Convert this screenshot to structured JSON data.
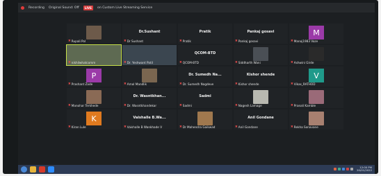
{
  "topbar": {
    "recording": "Recording",
    "audio": "Original Sound: Off",
    "live": "LIVE",
    "stream": "on Custom Live Streaming Service"
  },
  "participants": [
    {
      "label": "Rupali Pol",
      "kind": "photo",
      "color": "#6d5a4a"
    },
    {
      "label": "Dr Sushant",
      "center": "Dr.Sushant",
      "kind": "name"
    },
    {
      "label": "Pratik",
      "center": "Pratik",
      "kind": "name"
    },
    {
      "label": "Pankaj gosavi",
      "center": "Pankaj gosavi",
      "kind": "name"
    },
    {
      "label": "Manoj1983 Vaze",
      "kind": "avatar",
      "letter": "M",
      "color": "#9b3aa8"
    },
    {
      "label": "nikhilwhatcomm",
      "kind": "video",
      "color": "#5e6a52",
      "active": true
    },
    {
      "label": "Dr. Yeshwant Patil",
      "kind": "video",
      "color": "#3b4650"
    },
    {
      "label": "QCOM-BTD",
      "center": "QCOM-BTD",
      "kind": "name"
    },
    {
      "label": "Siddharth Wani",
      "kind": "photo",
      "color": "#4a4f55"
    },
    {
      "label": "Ashwini Girde",
      "kind": "photo",
      "color": "#2a2a2a"
    },
    {
      "label": "Prashant Zade",
      "kind": "avatar",
      "letter": "P",
      "color": "#9b3aa8"
    },
    {
      "label": "Amol Mandlik",
      "kind": "photo",
      "color": "#7a6650"
    },
    {
      "label": "Dr. Sumedh Nagdeve",
      "center": "Dr. Sumedh Na...",
      "kind": "name"
    },
    {
      "label": "Kishor shende",
      "center": "Kishor shende",
      "kind": "name"
    },
    {
      "label": "Vikas_RATHOD",
      "kind": "avatar",
      "letter": "V",
      "color": "#1f9a8a"
    },
    {
      "label": "Manohar Terkhede",
      "kind": "photo",
      "color": "#8a6a55"
    },
    {
      "label": "Dr. Wasntkhandekar",
      "center": "Dr. Wasntkhan...",
      "kind": "name"
    },
    {
      "label": "Sadmi",
      "center": "Sadmi",
      "kind": "name"
    },
    {
      "label": "Nagesh Lamage",
      "kind": "photo",
      "color": "#b8b8b0"
    },
    {
      "label": "Pranali Kamble",
      "kind": "photo",
      "color": "#9a6a78"
    },
    {
      "label": "Kiran Lule",
      "kind": "avatar",
      "letter": "K",
      "color": "#e07a1f"
    },
    {
      "label": "Vaishalle B Wankhade V",
      "center": "Vaishalle B.Wa...",
      "kind": "name"
    },
    {
      "label": "Dr Mahendra Gaikwad",
      "kind": "photo",
      "color": "#a0784e"
    },
    {
      "label": "Anil Gondane",
      "center": "Anil Gondane",
      "kind": "name"
    },
    {
      "label": "Rekha Sonavane",
      "kind": "photo",
      "color": "#a88070"
    }
  ],
  "taskbar": {
    "time": "12:00 PM",
    "date": "20/01/2022"
  }
}
